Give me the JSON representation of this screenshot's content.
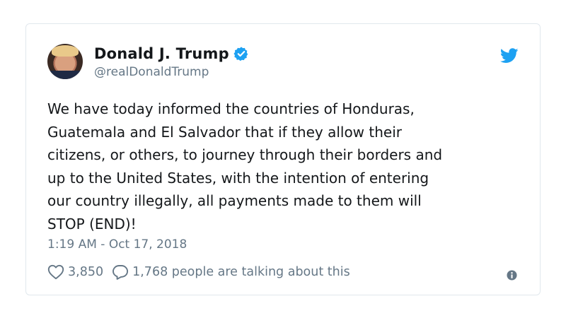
{
  "tweet": {
    "author_name": "Donald J. Trump",
    "handle": "@realDonaldTrump",
    "verified": true,
    "text": "We have today informed the countries of Honduras,\nGuatemala and El Salvador that if they allow their\ncitizens, or others, to journey through their borders and\nup to the United States, with the intention of entering\nour country illegally, all payments made to them will\nSTOP (END)!",
    "timestamp": "1:19 AM - Oct 17, 2018",
    "likes": "3,850",
    "talking": "1,768 people are talking about this"
  },
  "icons": {
    "verified": "verified-badge-icon",
    "brand": "twitter-bird-icon",
    "like": "heart-icon",
    "reply": "speech-bubble-icon",
    "info": "info-icon"
  },
  "colors": {
    "brand": "#1da1f2",
    "text": "#14171a",
    "secondary": "#657786",
    "border": "#e1e8ed"
  }
}
